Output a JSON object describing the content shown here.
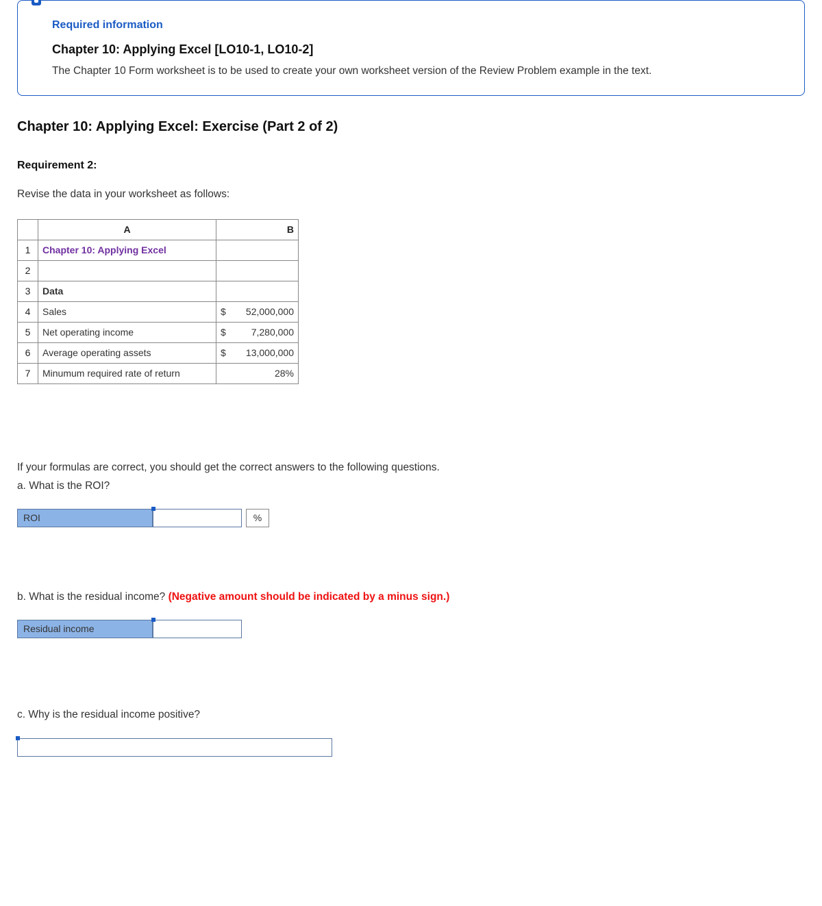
{
  "info_box": {
    "req_label": "Required information",
    "chapter_title": "Chapter 10: Applying Excel [LO10-1, LO10-2]",
    "text": "The Chapter 10 Form worksheet is to be used to create your own worksheet version of the Review Problem example in the text."
  },
  "exercise_title": "Chapter 10: Applying Excel: Exercise (Part 2 of 2)",
  "requirement_label": "Requirement 2:",
  "instruction": "Revise the data in your worksheet as follows:",
  "grid": {
    "col_a": "A",
    "col_b": "B",
    "rows": {
      "r1": {
        "num": "1",
        "a": "Chapter 10: Applying Excel",
        "b": ""
      },
      "r2": {
        "num": "2",
        "a": "",
        "b": ""
      },
      "r3": {
        "num": "3",
        "a": "Data",
        "b": ""
      },
      "r4": {
        "num": "4",
        "a": "Sales",
        "sym": "$",
        "val": "52,000,000"
      },
      "r5": {
        "num": "5",
        "a": "Net operating income",
        "sym": "$",
        "val": "7,280,000"
      },
      "r6": {
        "num": "6",
        "a": "Average operating assets",
        "sym": "$",
        "val": "13,000,000"
      },
      "r7": {
        "num": "7",
        "a": "Minumum required rate of return",
        "b": "28%"
      }
    }
  },
  "q_intro": "If your formulas are correct, you should get the correct answers to the following questions.",
  "qa": {
    "text": "a. What is the ROI?",
    "label": "ROI",
    "value": "",
    "unit": "%"
  },
  "qb": {
    "text_prefix": "b. What is the residual income? ",
    "text_red": "(Negative amount should be indicated by a minus sign.)",
    "label": "Residual income",
    "value": ""
  },
  "qc": {
    "text": "c. Why is the residual income positive?",
    "value": ""
  }
}
